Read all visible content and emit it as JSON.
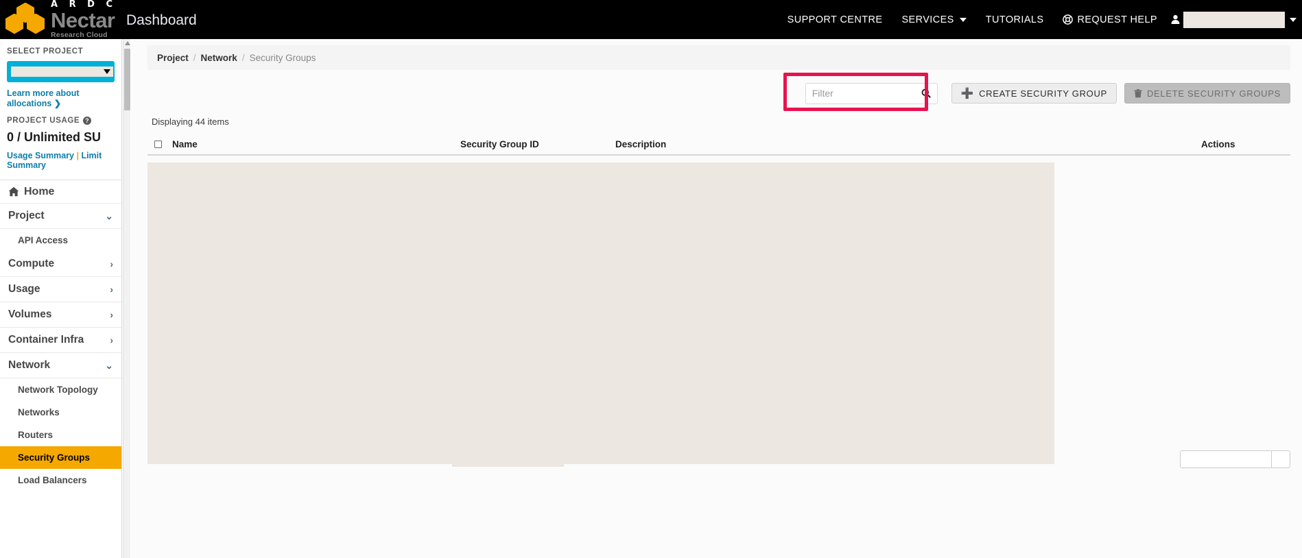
{
  "topnav": {
    "brand": {
      "ardc": "A R D C",
      "nectar": "Nectar",
      "subtitle": "Research Cloud",
      "dashboard": "Dashboard"
    },
    "items": [
      {
        "label": "SUPPORT CENTRE",
        "icon": null,
        "caret": false
      },
      {
        "label": "SERVICES",
        "icon": null,
        "caret": true
      },
      {
        "label": "TUTORIALS",
        "icon": null,
        "caret": false
      },
      {
        "label": "REQUEST HELP",
        "icon": "life-ring-icon",
        "caret": false
      }
    ],
    "user": {
      "icon": "user-icon",
      "name": "",
      "redacted": true
    }
  },
  "sidebar": {
    "select_project_label": "SELECT PROJECT",
    "project_value": "",
    "learn_more": "Learn more about allocations ❯",
    "project_usage_label": "PROJECT USAGE",
    "help_glyph": "?",
    "usage_value": "0 / Unlimited SU",
    "usage_summary": "Usage Summary",
    "separator": "|",
    "limit_summary": "Limit Summary",
    "home": "Home",
    "items": [
      {
        "label": "Project",
        "level": "group",
        "chevron": "⌄",
        "active": false
      },
      {
        "label": "API Access",
        "level": "sub",
        "chevron": "",
        "active": false
      },
      {
        "label": "Compute",
        "level": "group",
        "chevron": "›",
        "active": false
      },
      {
        "label": "Usage",
        "level": "group",
        "chevron": "›",
        "active": false
      },
      {
        "label": "Volumes",
        "level": "group",
        "chevron": "›",
        "active": false
      },
      {
        "label": "Container Infra",
        "level": "group",
        "chevron": "›",
        "active": false
      },
      {
        "label": "Network",
        "level": "group",
        "chevron": "⌄",
        "active": false
      },
      {
        "label": "Network Topology",
        "level": "sub",
        "chevron": "",
        "active": false
      },
      {
        "label": "Networks",
        "level": "sub",
        "chevron": "",
        "active": false
      },
      {
        "label": "Routers",
        "level": "sub",
        "chevron": "",
        "active": false
      },
      {
        "label": "Security Groups",
        "level": "sub",
        "chevron": "",
        "active": true
      },
      {
        "label": "Load Balancers",
        "level": "sub",
        "chevron": "",
        "active": false
      }
    ]
  },
  "breadcrumb": {
    "item1": "Project",
    "sep1": "/",
    "item2": "Network",
    "sep2": "/",
    "current": "Security Groups"
  },
  "toolbar": {
    "filter_placeholder": "Filter",
    "filter_value": "",
    "search_icon": "search-icon",
    "create_label": "CREATE SECURITY GROUP",
    "create_icon": "plus-icon",
    "delete_label": "DELETE SECURITY GROUPS",
    "delete_icon": "trash-icon",
    "delete_disabled": true,
    "highlight_color": "#e8124e"
  },
  "table": {
    "displaying": "Displaying 44 items",
    "columns": [
      "Name",
      "Security Group ID",
      "Description",
      "Actions"
    ],
    "rows": []
  },
  "colors": {
    "accent_orange": "#f5a800",
    "accent_cyan": "#00b0d8",
    "link_blue": "#0d7ea8",
    "highlight_pink": "#e8124e",
    "redaction": "#ece7e0"
  }
}
